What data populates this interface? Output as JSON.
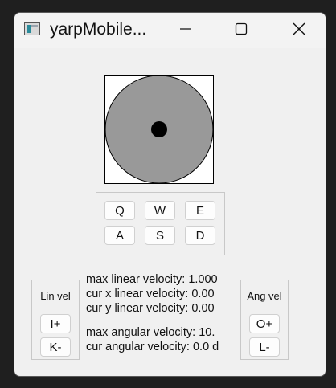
{
  "window": {
    "title": "yarpMobile..."
  },
  "keys": {
    "row1": [
      "Q",
      "W",
      "E"
    ],
    "row2": [
      "A",
      "S",
      "D"
    ]
  },
  "linear": {
    "title": "Lin vel",
    "increase_label": "I+",
    "decrease_label": "K-"
  },
  "angular": {
    "title": "Ang vel",
    "increase_label": "O+",
    "decrease_label": "L-"
  },
  "readouts": {
    "max_linear": "max linear velocity: 1.000",
    "cur_x_linear": "cur x linear velocity: 0.00",
    "cur_y_linear": "cur y linear velocity: 0.00",
    "max_angular": "max angular velocity: 10.",
    "cur_angular": "cur angular velocity: 0.0 d"
  },
  "colors": {
    "joystick_disc": "#999999",
    "joystick_knob": "#000000"
  },
  "icons": {
    "app": "app-icon",
    "minimize": "minimize-icon",
    "maximize": "maximize-icon",
    "close": "close-icon"
  }
}
